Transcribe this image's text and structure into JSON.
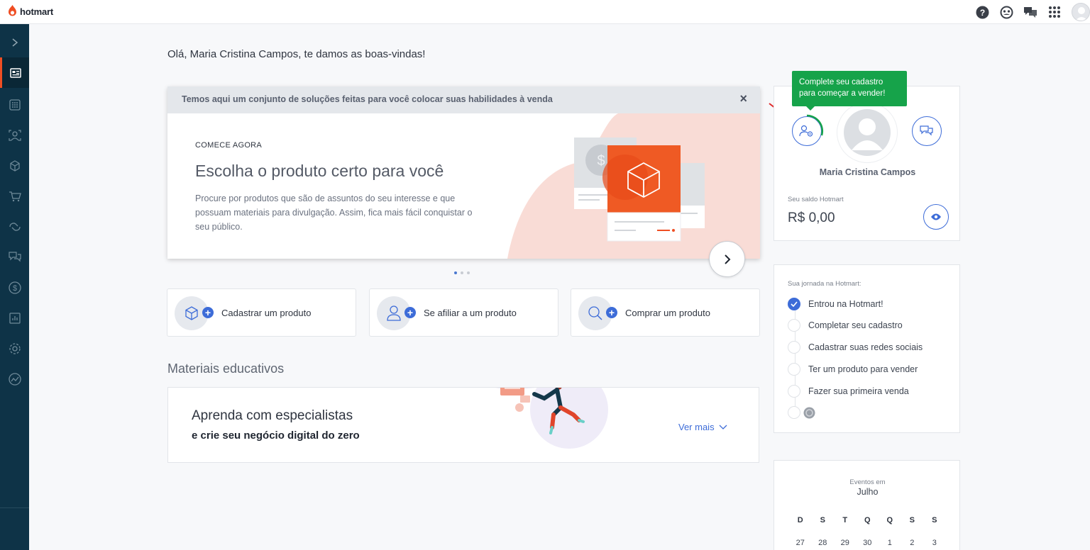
{
  "header": {
    "brand": "hotmart",
    "icons": [
      "help-icon",
      "community-icon",
      "chat-icon",
      "apps-grid-icon",
      "user-avatar-icon"
    ],
    "brand_color": "#ef4e23"
  },
  "sidebar": {
    "items": [
      {
        "icon": "expand-chevron-icon"
      },
      {
        "icon": "dashboard-icon",
        "active": true
      },
      {
        "icon": "products-grid-icon"
      },
      {
        "icon": "affiliates-icon"
      },
      {
        "icon": "box-icon"
      },
      {
        "icon": "cart-icon"
      },
      {
        "icon": "subscriptions-icon"
      },
      {
        "icon": "messages-icon"
      },
      {
        "icon": "money-icon"
      },
      {
        "icon": "reports-icon"
      },
      {
        "icon": "settings-icon"
      },
      {
        "icon": "analytics-icon"
      }
    ],
    "background": "#0e3347"
  },
  "main": {
    "greeting": "Olá, Maria Cristina Campos, te damos as boas-vindas!",
    "carousel": {
      "header": "Temos aqui um conjunto de soluções feitas para você colocar suas habilidades à venda",
      "close": "×",
      "kicker": "COMECE AGORA",
      "title": "Escolha o produto certo para você",
      "description": "Procure por produtos que são de assuntos do seu interesse e que possuam materiais para divulgação. Assim, fica mais fácil conquistar o seu público.",
      "slides": 3,
      "active_slide": 1
    },
    "actions": [
      {
        "label": "Cadastrar um produto",
        "icon": "box-icon"
      },
      {
        "label": "Se afiliar a um produto",
        "icon": "user-icon"
      },
      {
        "label": "Comprar um produto",
        "icon": "search-icon"
      }
    ],
    "materials": {
      "title": "Materiais educativos",
      "heading": "Aprenda com especialistas",
      "subheading": "e crie seu negócio digital do zero",
      "link": "Ver mais"
    }
  },
  "right": {
    "tooltip": "Complete seu cadastro para começar a vender!",
    "profile": {
      "name": "Maria Cristina Campos",
      "balance_label": "Seu saldo Hotmart",
      "balance": "R$ 0,00"
    },
    "journey": {
      "title": "Sua jornada na Hotmart:",
      "steps": [
        {
          "label": "Entrou na Hotmart!",
          "done": true
        },
        {
          "label": "Completar seu cadastro",
          "done": false
        },
        {
          "label": "Cadastrar suas redes sociais",
          "done": false
        },
        {
          "label": "Ter um produto para vender",
          "done": false
        },
        {
          "label": "Fazer sua primeira venda",
          "done": false
        }
      ]
    },
    "calendar": {
      "label": "Eventos em",
      "month": "Julho",
      "weekdays": [
        "D",
        "S",
        "T",
        "Q",
        "Q",
        "S",
        "S"
      ],
      "week1": [
        "27",
        "28",
        "29",
        "30",
        "1",
        "2",
        "3"
      ]
    }
  }
}
